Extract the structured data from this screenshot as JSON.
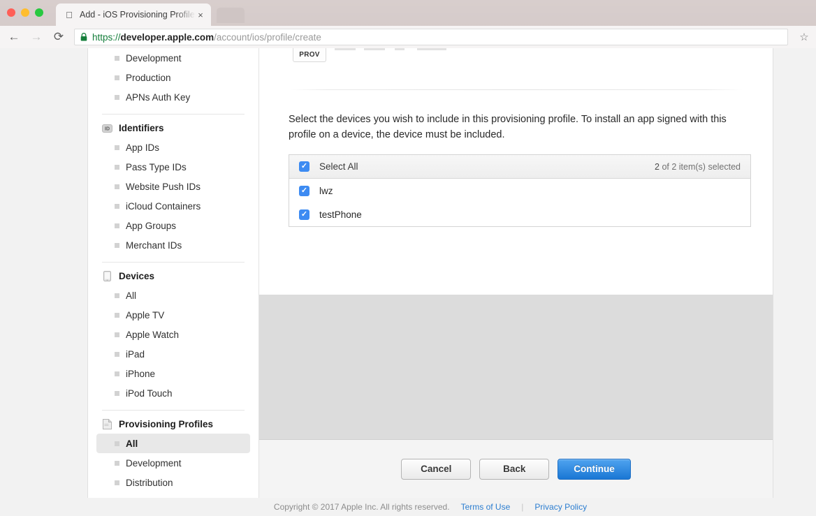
{
  "browser": {
    "tab": {
      "title": "Add - iOS Provisioning Profiles",
      "favicon": "apple-icon",
      "close_glyph": "×"
    },
    "new_tab_label": "",
    "toolbar": {
      "back_glyph": "←",
      "forward_glyph": "→",
      "reload_glyph": "⟳",
      "star_glyph": "☆",
      "url": {
        "scheme": "https://",
        "host": "developer.apple.com",
        "path": "/account/ios/profile/create"
      }
    }
  },
  "sidebar": {
    "groups": [
      {
        "header": null,
        "header_icon": null,
        "items": [
          {
            "label": "Development",
            "active": false
          },
          {
            "label": "Production",
            "active": false
          },
          {
            "label": "APNs Auth Key",
            "active": false
          }
        ]
      },
      {
        "header": "Identifiers",
        "header_icon": "id-badge-icon",
        "items": [
          {
            "label": "App IDs",
            "active": false
          },
          {
            "label": "Pass Type IDs",
            "active": false
          },
          {
            "label": "Website Push IDs",
            "active": false
          },
          {
            "label": "iCloud Containers",
            "active": false
          },
          {
            "label": "App Groups",
            "active": false
          },
          {
            "label": "Merchant IDs",
            "active": false
          }
        ]
      },
      {
        "header": "Devices",
        "header_icon": "device-phone-icon",
        "items": [
          {
            "label": "All",
            "active": false
          },
          {
            "label": "Apple TV",
            "active": false
          },
          {
            "label": "Apple Watch",
            "active": false
          },
          {
            "label": "iPad",
            "active": false
          },
          {
            "label": "iPhone",
            "active": false
          },
          {
            "label": "iPod Touch",
            "active": false
          }
        ]
      },
      {
        "header": "Provisioning Profiles",
        "header_icon": "document-icon",
        "items": [
          {
            "label": "All",
            "active": true
          },
          {
            "label": "Development",
            "active": false
          },
          {
            "label": "Distribution",
            "active": false
          }
        ]
      }
    ]
  },
  "main": {
    "step_icon_label": "PROV",
    "description": "Select the devices you wish to include in this provisioning profile. To install an app signed with this profile on a device, the device must be included.",
    "device_table": {
      "select_all_label": "Select All",
      "selected_count": "2",
      "selected_suffix": "of 2 item(s) selected",
      "rows": [
        {
          "label": "lwz",
          "checked": true
        },
        {
          "label": "testPhone",
          "checked": true
        }
      ],
      "select_all_checked": true,
      "check_glyph": "✓"
    },
    "actions": {
      "cancel_label": "Cancel",
      "back_label": "Back",
      "continue_label": "Continue"
    }
  },
  "footer": {
    "copyright": "Copyright © 2017 Apple Inc. All rights reserved.",
    "terms_label": "Terms of Use",
    "pipe": "|",
    "privacy_label": "Privacy Policy"
  },
  "colors": {
    "accent_blue": "#1a77d4",
    "checkbox_blue": "#3d8bf2",
    "link_blue": "#2b7dd0",
    "secure_green": "#157e3b"
  }
}
